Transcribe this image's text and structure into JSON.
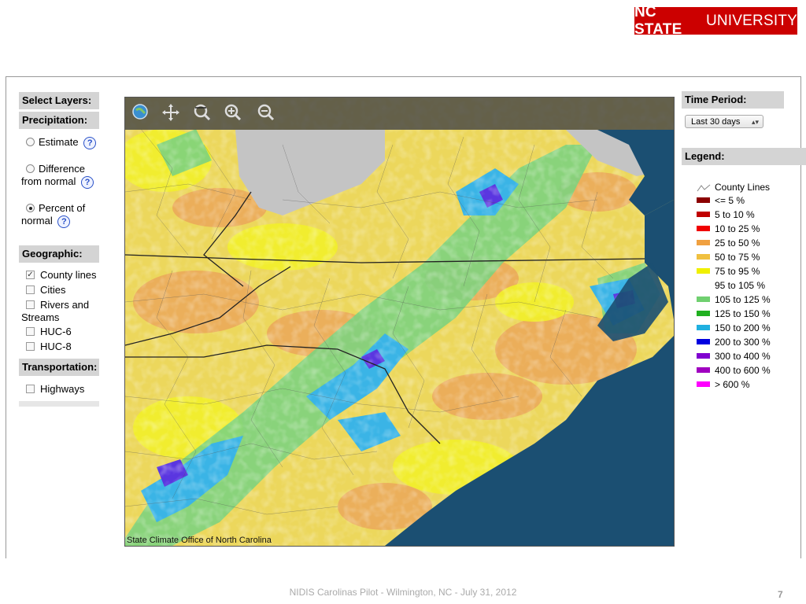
{
  "logo": {
    "bold": "NC STATE",
    "thin": "UNIVERSITY"
  },
  "left_panel": {
    "select_layers": "Select Layers:",
    "precipitation_header": "Precipitation:",
    "precip_options": [
      {
        "label": "Estimate",
        "selected": false
      },
      {
        "label_line1": "Difference",
        "label_line2": "from normal",
        "selected": false
      },
      {
        "label_line1": "Percent of",
        "label_line2": "normal",
        "selected": true
      }
    ],
    "geographic_header": "Geographic:",
    "geo_options": [
      {
        "label": "County lines",
        "checked": true
      },
      {
        "label": "Cities",
        "checked": false
      },
      {
        "label_line1": "Rivers and",
        "label_line2": "Streams",
        "checked": false
      },
      {
        "label": "HUC-6",
        "checked": false
      },
      {
        "label": "HUC-8",
        "checked": false
      }
    ],
    "transportation_header": "Transportation:",
    "transport_options": [
      {
        "label": "Highways",
        "checked": false
      }
    ]
  },
  "map": {
    "credit": "State Climate Office of North Carolina",
    "tools": [
      "globe-icon",
      "pan-icon",
      "zoom-box-icon",
      "zoom-in-icon",
      "zoom-out-icon"
    ]
  },
  "right_panel": {
    "time_period_header": "Time Period:",
    "time_period_value": "Last 30 days",
    "legend_header": "Legend:",
    "legend": [
      {
        "label": "County Lines",
        "color": ""
      },
      {
        "label": "<= 5 %",
        "color": "#8b0000"
      },
      {
        "label": "5 to 10 %",
        "color": "#c00000"
      },
      {
        "label": "10 to 25 %",
        "color": "#f00000"
      },
      {
        "label": "25 to 50 %",
        "color": "#f0a040"
      },
      {
        "label": "50 to 75 %",
        "color": "#f0c040"
      },
      {
        "label": "75 to 95 %",
        "color": "#f0f000"
      },
      {
        "label": "95 to 105 %",
        "color": "#ffffff"
      },
      {
        "label": "105 to 125 %",
        "color": "#70d070"
      },
      {
        "label": "125 to 150 %",
        "color": "#20b020"
      },
      {
        "label": "150 to 200 %",
        "color": "#20b0e0"
      },
      {
        "label": "200 to 300 %",
        "color": "#0000e0"
      },
      {
        "label": "300 to 400 %",
        "color": "#8000d0"
      },
      {
        "label": "400 to 600 %",
        "color": "#a000c0"
      },
      {
        "label": "> 600 %",
        "color": "#ff00ff"
      }
    ]
  },
  "footer": {
    "text": "NIDIS Carolinas Pilot - Wilmington, NC - July 31, 2012",
    "page": "7"
  }
}
